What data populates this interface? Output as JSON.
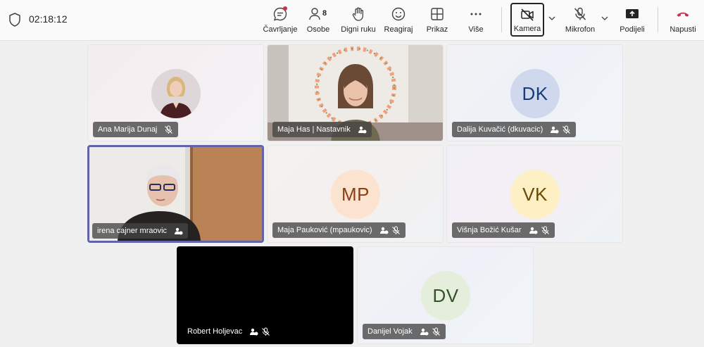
{
  "meeting": {
    "elapsed": "02:18:12"
  },
  "toolbar": {
    "chat_label": "Čavrljanje",
    "people_label": "Osobe",
    "people_count": "8",
    "raise_hand_label": "Digni ruku",
    "react_label": "Reagiraj",
    "view_label": "Prikaz",
    "more_label": "Više",
    "camera_label": "Kamera",
    "mic_label": "Mikrofon",
    "share_label": "Podijeli",
    "leave_label": "Napusti"
  },
  "participants": [
    {
      "name": "Ana Marija Dunaj",
      "video": "photo-avatar",
      "muted": true
    },
    {
      "name": "Maja Has | Nastavnik",
      "video": "camera",
      "muted": false
    },
    {
      "name": "Dalija Kuvačić (dkuvacic)",
      "initials": "DK",
      "muted": true
    },
    {
      "name": "irena cajner mraovic",
      "video": "camera",
      "muted": false,
      "active": true
    },
    {
      "name": "Maja Pauković (mpaukovic)",
      "initials": "MP",
      "muted": true
    },
    {
      "name": "Višnja Božić Kušar",
      "initials": "VK",
      "muted": true
    },
    {
      "name": "Robert Holjevac",
      "video": "off-black",
      "muted": true
    },
    {
      "name": "Danijel Vojak",
      "initials": "DV",
      "muted": true
    }
  ],
  "colors": {
    "accent": "#6264a7",
    "leave": "#c4314b",
    "dk_bg": "#cfd8ec",
    "dk_fg": "#173d7a",
    "mp_bg": "#fbe3cf",
    "mp_fg": "#8a3f14",
    "vk_bg": "#fdf0c4",
    "vk_fg": "#6b4a05",
    "dv_bg": "#e4eedb",
    "dv_fg": "#34502a"
  }
}
